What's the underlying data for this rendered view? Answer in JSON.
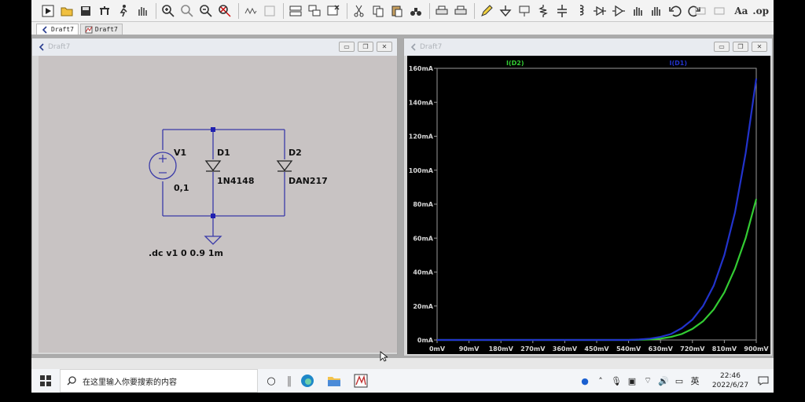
{
  "tabs": [
    {
      "label": "Draft7",
      "kind": "schematic"
    },
    {
      "label": "Draft7",
      "kind": "waveform"
    }
  ],
  "schematic_window": {
    "title": "Draft7"
  },
  "waveform_window": {
    "title": "Draft7"
  },
  "toolbar": {
    "text_tools": [
      "Aa",
      ".op"
    ]
  },
  "schematic": {
    "components": [
      {
        "ref": "V1",
        "value": "0,1",
        "type": "voltage-source"
      },
      {
        "ref": "D1",
        "value": "1N4148",
        "type": "diode"
      },
      {
        "ref": "D2",
        "value": "DAN217",
        "type": "diode"
      }
    ],
    "directive": ".dc v1 0 0.9 1m",
    "wire_color": "#3030b0",
    "node_color": "#2020b0"
  },
  "chart_data": {
    "type": "line",
    "title": "",
    "xlabel": "",
    "ylabel": "",
    "xlim": [
      0,
      900
    ],
    "ylim": [
      0,
      160
    ],
    "x_ticks": [
      "0mV",
      "90mV",
      "180mV",
      "270mV",
      "360mV",
      "450mV",
      "540mV",
      "630mV",
      "720mV",
      "810mV",
      "900mV"
    ],
    "y_ticks": [
      "0mA",
      "20mA",
      "40mA",
      "60mA",
      "80mA",
      "100mA",
      "120mA",
      "140mA",
      "160mA"
    ],
    "grid": false,
    "legend": "top",
    "series": [
      {
        "name": "I(D2)",
        "color": "#33cc33",
        "x": [
          0,
          540,
          600,
          630,
          660,
          690,
          720,
          750,
          780,
          810,
          840,
          870,
          900
        ],
        "y": [
          0,
          0,
          0.3,
          0.8,
          1.8,
          3.5,
          6.5,
          11,
          18,
          28,
          42,
          60,
          83
        ]
      },
      {
        "name": "I(D1)",
        "color": "#2233cc",
        "x": [
          0,
          540,
          570,
          600,
          630,
          660,
          690,
          720,
          750,
          780,
          810,
          840,
          870,
          900
        ],
        "y": [
          0,
          0,
          0.3,
          0.8,
          1.8,
          3.5,
          7,
          12,
          20,
          32,
          50,
          75,
          110,
          154
        ]
      }
    ]
  },
  "taskbar": {
    "search_placeholder": "在这里输入你要搜索的内容",
    "ime": "英",
    "time": "22:46",
    "date": "2022/6/27"
  }
}
